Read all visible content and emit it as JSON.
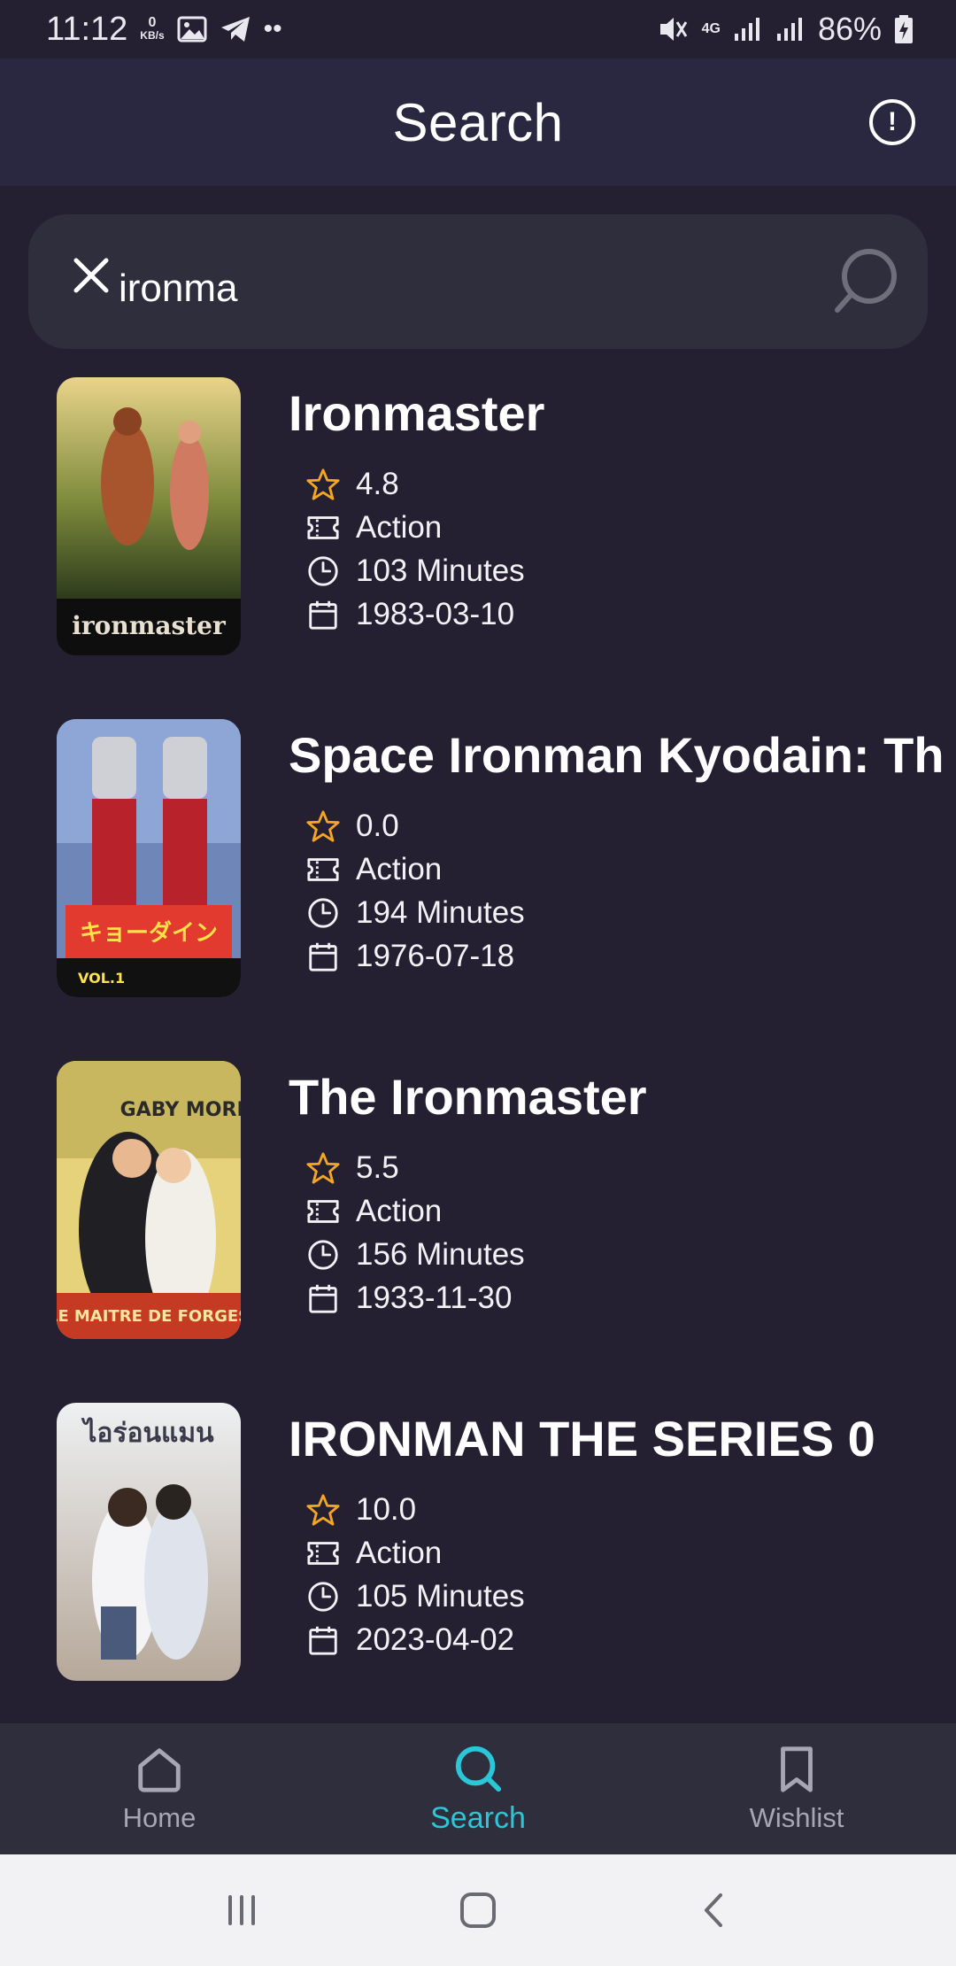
{
  "status_bar": {
    "time": "11:12",
    "net_speed_value": "0",
    "net_speed_unit": "KB/s",
    "network": "4G",
    "battery": "86%"
  },
  "header": {
    "title": "Search"
  },
  "search": {
    "value": "ironma",
    "placeholder": ""
  },
  "movies": [
    {
      "title": "Ironmaster",
      "rating": "4.8",
      "genre": "Action",
      "duration": "103 Minutes",
      "date": "1983-03-10"
    },
    {
      "title": "Space Ironman Kyodain: Th",
      "rating": "0.0",
      "genre": "Action",
      "duration": "194 Minutes",
      "date": "1976-07-18"
    },
    {
      "title": "The Ironmaster",
      "rating": "5.5",
      "genre": "Action",
      "duration": "156 Minutes",
      "date": "1933-11-30"
    },
    {
      "title": "IRONMAN THE SERIES 0",
      "rating": "10.0",
      "genre": "Action",
      "duration": "105 Minutes",
      "date": "2023-04-02"
    }
  ],
  "posters": [
    {
      "logo_text": "ironmaster"
    },
    {
      "logo_text": "VOL.1"
    },
    {
      "logo_text": "GABY MORLAY"
    },
    {
      "logo_text": "ไอร่อนแมน"
    }
  ],
  "bottom_nav": {
    "items": [
      {
        "label": "Home",
        "icon": "home-icon"
      },
      {
        "label": "Search",
        "icon": "search-icon"
      },
      {
        "label": "Wishlist",
        "icon": "bookmark-icon"
      }
    ],
    "active": "Search"
  },
  "colors": {
    "background": "#242032",
    "appbar": "#2a2740",
    "surface": "#2e2e3c",
    "accent": "#2cc6d9",
    "star": "#f5a623"
  }
}
